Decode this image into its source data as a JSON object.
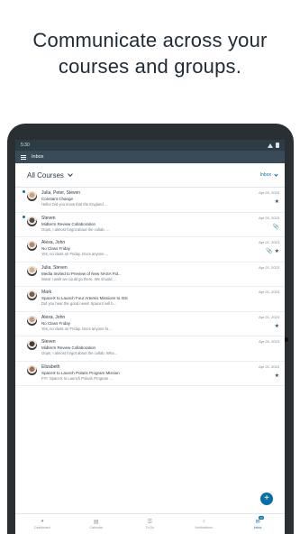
{
  "headline": {
    "line1": "Communicate across your",
    "line2": "courses and groups."
  },
  "status_bar": {
    "time": "5:30"
  },
  "app_bar": {
    "title": "Inbox"
  },
  "filter": {
    "courses": "All Courses",
    "scope": "Inbox"
  },
  "messages": [
    {
      "participants": "Julia, Peter, Steven",
      "subject": "Constant Change",
      "preview": "Hello! Did you know that the England ...",
      "date": "Apr 20, 2023",
      "unread": true,
      "starred": true,
      "attachment": false
    },
    {
      "participants": "Steven",
      "subject": "Midterm Review Collaboration",
      "preview": "Oops, I almost forgot about the collab. ...",
      "date": "Apr 20, 2023",
      "unread": true,
      "starred": false,
      "attachment": true
    },
    {
      "participants": "Alexa, John",
      "subject": "No Class Friday",
      "preview": "Yes, no class on Friday. Docs anyone ...",
      "date": "Apr 21, 2023",
      "unread": false,
      "starred": true,
      "attachment": true
    },
    {
      "participants": "Julia, Steven",
      "subject": "Media Invited to Preview of New NASA Fid...",
      "preview": "Wow! I wish we could go there. We should ...",
      "date": "Apr 21, 2023",
      "unread": false,
      "starred": false,
      "attachment": false
    },
    {
      "participants": "Mark",
      "subject": "SpaceX to Launch Four Artemis Missions to ISS",
      "preview": "Did you hear the good news! SpaceX will b...",
      "date": "Apr 21, 2023",
      "unread": false,
      "starred": false,
      "attachment": false
    },
    {
      "participants": "Alexa, John",
      "subject": "No Class Friday",
      "preview": "Yes, no class on Friday. Docs anyone fo...",
      "date": "Apr 21, 2023",
      "unread": false,
      "starred": true,
      "attachment": false
    },
    {
      "participants": "Steven",
      "subject": "Midterm Review Collaboration",
      "preview": "Oops, I almost forgot about the collab. Wha...",
      "date": "Apr 20, 2023",
      "unread": false,
      "starred": false,
      "attachment": false
    },
    {
      "participants": "Elizabeth",
      "subject": "SpaceX to Launch Polaris Program Mission",
      "preview": "FYI: SpaceX to Launch Polaris Program ...",
      "date": "Apr 21, 2023",
      "unread": false,
      "starred": true,
      "attachment": false
    }
  ],
  "bottom_nav": [
    {
      "label": "Dashboard",
      "icon": "dashboard-icon"
    },
    {
      "label": "Calendar",
      "icon": "calendar-icon"
    },
    {
      "label": "To Do",
      "icon": "todo-icon"
    },
    {
      "label": "Notifications",
      "icon": "bell-icon"
    },
    {
      "label": "Inbox",
      "icon": "inbox-icon",
      "badge": "10",
      "active": true
    }
  ],
  "colors": {
    "brand": "#0770a3",
    "header": "#394b58",
    "text": "#2d3b45"
  }
}
